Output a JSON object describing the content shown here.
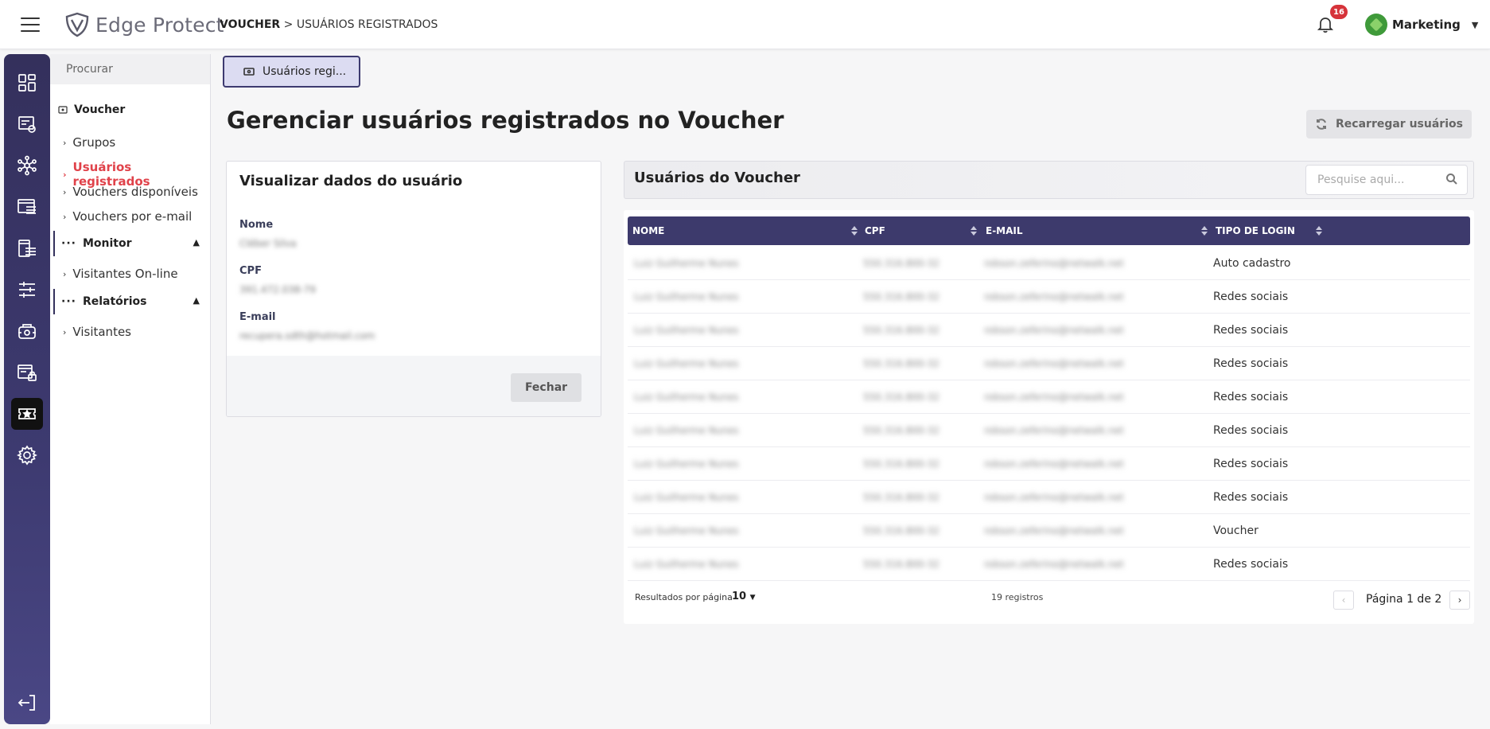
{
  "app": {
    "name": "Edge Protect"
  },
  "breadcrumb": {
    "section": "VOUCHER",
    "separator": ">",
    "page": "USUÁRIOS REGISTRADOS"
  },
  "header": {
    "notifications": "16",
    "user_name": "Marketing"
  },
  "rail": {
    "items": [
      {
        "icon": "dashboard-icon"
      },
      {
        "icon": "reports-icon"
      },
      {
        "icon": "network-icon"
      },
      {
        "icon": "browser-settings-icon"
      },
      {
        "icon": "policy-list-icon"
      },
      {
        "icon": "sliders-icon"
      },
      {
        "icon": "devices-icon"
      },
      {
        "icon": "secure-list-icon"
      },
      {
        "icon": "voucher-ticket-icon",
        "active": true
      },
      {
        "icon": "gear-icon"
      }
    ],
    "logout_icon": "logout-icon"
  },
  "subnav": {
    "search_placeholder": "Procurar",
    "section": "Voucher",
    "items": [
      "Grupos",
      "Usuários registrados",
      "Vouchers disponíveis",
      "Vouchers por e-mail"
    ],
    "active_item": "Usuários registrados",
    "group_monitor": "Monitor",
    "monitor_items": [
      "Visitantes On-line"
    ],
    "group_reports": "Relatórios",
    "reports_items": [
      "Visitantes"
    ]
  },
  "tab": {
    "label": "Usuários regi..."
  },
  "main": {
    "title": "Gerenciar usuários registrados no Voucher",
    "reload_label": "Recarregar usuários"
  },
  "user_card": {
    "title": "Visualizar dados do usuário",
    "name_label": "Nome",
    "name_value": "Cléber Silva",
    "cpf_label": "CPF",
    "cpf_value": "391.472.038-79",
    "email_label": "E-mail",
    "email_value": "recupera.sdth@hotmail.com",
    "close_label": "Fechar"
  },
  "users_panel": {
    "title": "Usuários do Voucher",
    "search_placeholder": "Pesquise aqui...",
    "columns": [
      "NOME",
      "CPF",
      "E-MAIL",
      "TIPO DE LOGIN"
    ],
    "rows": [
      {
        "name": "Luiz Guilherme Nunes",
        "cpf": "550.316.800-32",
        "email": "robson.zeferino@netwalk.net",
        "login": "Auto cadastro"
      },
      {
        "name": "Luiz Guilherme Nunes",
        "cpf": "550.316.800-32",
        "email": "robson.zeferino@netwalk.net",
        "login": "Redes sociais"
      },
      {
        "name": "Luiz Guilherme Nunes",
        "cpf": "550.316.800-32",
        "email": "robson.zeferino@netwalk.net",
        "login": "Redes sociais"
      },
      {
        "name": "Luiz Guilherme Nunes",
        "cpf": "550.316.800-32",
        "email": "robson.zeferino@netwalk.net",
        "login": "Redes sociais"
      },
      {
        "name": "Luiz Guilherme Nunes",
        "cpf": "550.316.800-32",
        "email": "robson.zeferino@netwalk.net",
        "login": "Redes sociais"
      },
      {
        "name": "Luiz Guilherme Nunes",
        "cpf": "550.316.800-32",
        "email": "robson.zeferino@netwalk.net",
        "login": "Redes sociais"
      },
      {
        "name": "Luiz Guilherme Nunes",
        "cpf": "550.316.800-32",
        "email": "robson.zeferino@netwalk.net",
        "login": "Redes sociais"
      },
      {
        "name": "Luiz Guilherme Nunes",
        "cpf": "550.316.800-32",
        "email": "robson.zeferino@netwalk.net",
        "login": "Redes sociais"
      },
      {
        "name": "Luiz Guilherme Nunes",
        "cpf": "550.316.800-32",
        "email": "robson.zeferino@netwalk.net",
        "login": "Voucher"
      },
      {
        "name": "Luiz Guilherme Nunes",
        "cpf": "550.316.800-32",
        "email": "robson.zeferino@netwalk.net",
        "login": "Redes sociais"
      }
    ],
    "per_page_label": "Resultados por página",
    "per_page_value": "10",
    "records": "19 registros",
    "pagination": "Página 1 de 2"
  },
  "colors": {
    "primary": "#3d3a6c",
    "accent": "#e0424a",
    "badge": "#d6333a"
  }
}
